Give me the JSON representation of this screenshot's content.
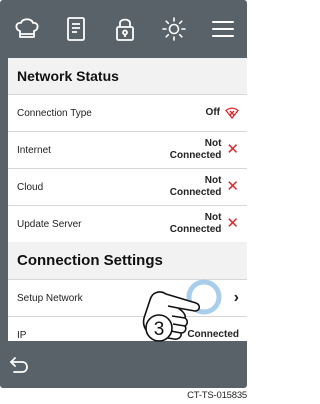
{
  "network_status": {
    "title": "Network Status",
    "rows": [
      {
        "label": "Connection Type",
        "value": "Off"
      },
      {
        "label": "Internet",
        "value_line1": "Not",
        "value_line2": "Connected"
      },
      {
        "label": "Cloud",
        "value_line1": "Not",
        "value_line2": "Connected"
      },
      {
        "label": "Update Server",
        "value_line1": "Not",
        "value_line2": "Connected"
      }
    ]
  },
  "connection_settings": {
    "title": "Connection Settings",
    "rows": [
      {
        "label": "Setup Network"
      },
      {
        "label": "IP",
        "value": "Connected"
      }
    ]
  },
  "callout": {
    "step": "3"
  },
  "reference_code": "CT-TS-015835",
  "colors": {
    "frame": "#5a6269",
    "error_red": "#e0262d",
    "callout_blue": "#9ec9ea"
  },
  "icons": [
    "chef-hat-icon",
    "recipe-book-icon",
    "lock-icon",
    "sun-icon",
    "menu-icon",
    "wifi-off-icon",
    "close-icon",
    "chevron-right-icon",
    "back-arrow-icon",
    "pointing-hand-icon"
  ]
}
